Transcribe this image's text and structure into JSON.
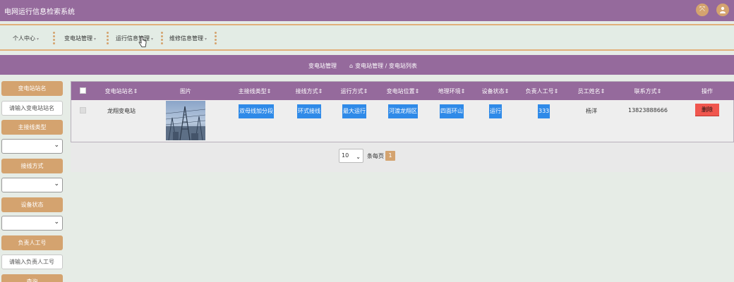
{
  "app": {
    "title": "电网运行信息检索系统"
  },
  "topbar": {
    "icons": [
      "expand-icon",
      "user-icon"
    ],
    "accent": "#956a9c",
    "button_color": "#d4a36f"
  },
  "nav": {
    "items": [
      {
        "label": "个人中心"
      },
      {
        "label": "变电站管理"
      },
      {
        "label": "运行信息管理"
      },
      {
        "label": "维修信息管理"
      }
    ]
  },
  "breadcrumb": {
    "title": "变电站管理",
    "path": "变电站管理 / 变电站列表"
  },
  "sidebar": {
    "station_name_label": "变电站站名",
    "station_name_placeholder": "请输入变电站站名",
    "line_type_label": "主接线类型",
    "wiring_label": "接线方式",
    "device_status_label": "设备状态",
    "person_no_label": "负责人工号",
    "person_no_placeholder": "请输入负责人工号",
    "query_label": "查询"
  },
  "table": {
    "headers": [
      "变电站站名",
      "图片",
      "主接线类型",
      "接线方式",
      "运行方式",
      "变电站位置",
      "地理环境",
      "设备状态",
      "负责人工号",
      "员工姓名",
      "联系方式",
      "操作"
    ],
    "rows": [
      {
        "name": "龙翔变电站",
        "line_type": "双母线加分段",
        "wiring": "环式接线",
        "operation": "最大运行",
        "location": "河渡龙翔区",
        "environment": "四面环山",
        "status": "运行",
        "person_no": "333",
        "employee": "杨洋",
        "phone": "13823888666",
        "action": "删除"
      }
    ]
  },
  "pager": {
    "page_size": "10",
    "per_page_label": "条每页",
    "current_page": "1"
  },
  "colors": {
    "chip": "#2f8ae8",
    "delete": "#f0564e"
  }
}
